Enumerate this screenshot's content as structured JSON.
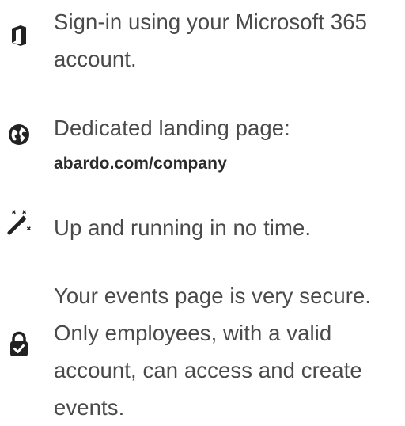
{
  "features": [
    {
      "icon": "microsoft-office-icon",
      "text": "Sign-in using your Microsoft 365 account."
    },
    {
      "icon": "globe-icon",
      "text": "Dedicated landing page:",
      "link": "abardo.com/company"
    },
    {
      "icon": "magic-wand-icon",
      "text": "Up and running in no time."
    },
    {
      "icon": "secure-lock-check-icon",
      "text": "Your events page is very secure. Only employees, with a valid account, can access and create events."
    }
  ]
}
